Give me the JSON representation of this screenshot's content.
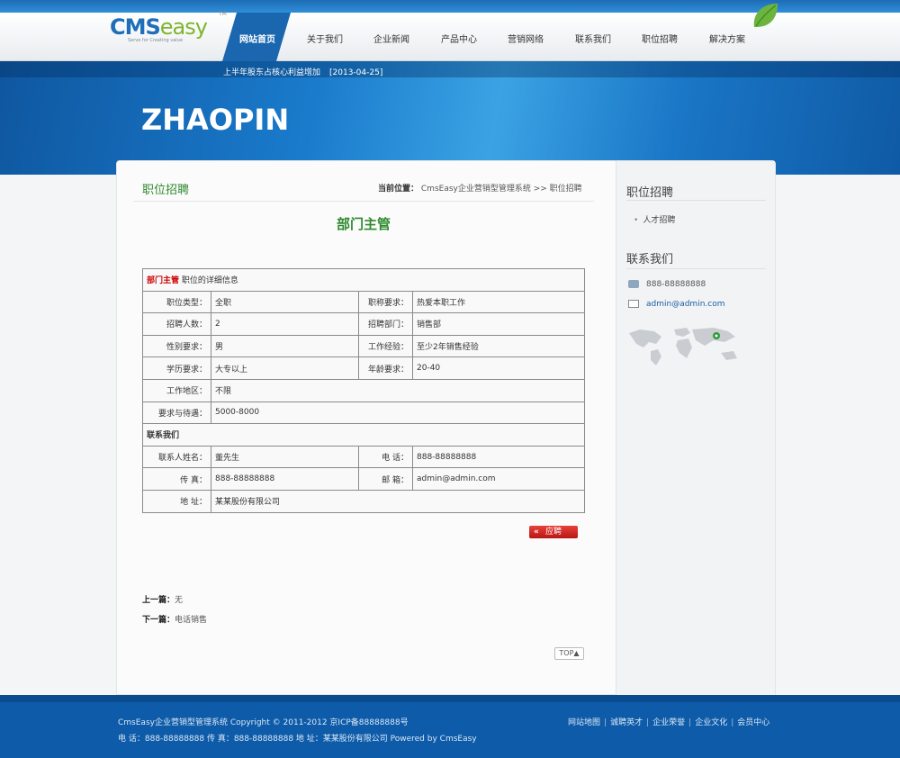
{
  "header": {
    "logo_cms": "CMS",
    "logo_easy": "easy",
    "logo_tm": "TM",
    "logo_tagline": "Serve for Creating value",
    "nav": [
      "网站首页",
      "关于我们",
      "企业新闻",
      "产品中心",
      "营销网络",
      "联系我们",
      "职位招聘",
      "解决方案"
    ],
    "active_nav": "网站首页"
  },
  "ticker": {
    "text": "上半年股东占核心利益增加",
    "date": "[2013-04-25]"
  },
  "banner": {
    "title": "ZHAOPIN"
  },
  "main": {
    "heading": "职位招聘",
    "breadcrumb_label": "当前位置：",
    "breadcrumb_path": "CmsEasy企业营销型管理系统 >> 职位招聘",
    "job_title": "部门主管",
    "table": {
      "caption_red": "部门主管",
      "caption_rest": "职位的详细信息",
      "rows": [
        [
          "职位类型：",
          "全职",
          "职称要求：",
          "热爱本职工作"
        ],
        [
          "招聘人数：",
          "2",
          "招聘部门：",
          "销售部"
        ],
        [
          "性别要求：",
          "男",
          "工作经验：",
          "至少2年销售经验"
        ],
        [
          "学历要求：",
          "大专以上",
          "年龄要求：",
          "20-40"
        ]
      ],
      "area_label": "工作地区：",
      "area_value": "不限",
      "salary_label": "要求与待遇：",
      "salary_value": "5000-8000",
      "contact_header": "联系我们",
      "contact_rows": [
        [
          "联系人姓名：",
          "董先生",
          "电 话：",
          "888-88888888"
        ],
        [
          "传 真：",
          "888-88888888",
          "邮 箱：",
          "admin@admin.com"
        ]
      ],
      "address_label": "地 址：",
      "address_value": "某某股份有限公司"
    },
    "apply_label": "应聘",
    "apply_arrow": "«",
    "prev_label": "上一篇：",
    "prev_value": "无",
    "next_label": "下一篇：",
    "next_value": "电话销售",
    "top_label": "TOP▲"
  },
  "sidebar": {
    "heading1": "职位招聘",
    "item1": "人才招聘",
    "heading2": "联系我们",
    "phone": "888-88888888",
    "email": "admin@admin.com"
  },
  "footer": {
    "line1": "CmsEasy企业营销型管理系统  Copyright © 2011-2012  京ICP备88888888号",
    "line2": "电 话：888-88888888  传 真：888-88888888  地 址：某某股份有限公司  Powered by  CmsEasy",
    "links": [
      "网站地图",
      "诚聘英才",
      "企业荣誉",
      "企业文化",
      "会员中心"
    ]
  },
  "colors": {
    "accent_green": "#2f8a2f",
    "brand_blue": "#1a67b0",
    "apply_red": "#c81e18"
  }
}
